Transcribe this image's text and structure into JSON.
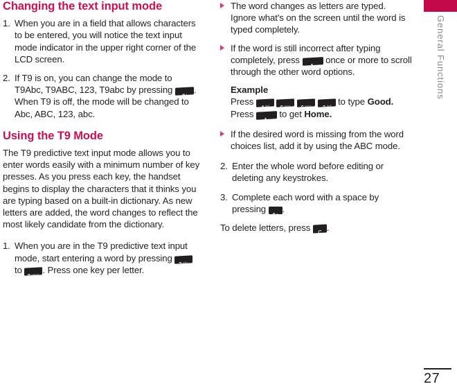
{
  "meta": {
    "accent_pink": "#cc1052",
    "tab_bar_color": "#c4084c",
    "key_color": "#231f20",
    "text_color": "#231f20"
  },
  "sidebar": {
    "chapter_label": "General Functions"
  },
  "folio": {
    "page_number": "27"
  },
  "left_column": {
    "heading_1": "Changing the text input mode",
    "item1": {
      "number": "1.",
      "text": "When you are in a field that allows characters to be entered, you will notice the text input mode indicator in the upper right corner of the LCD screen."
    },
    "item2": {
      "number": "2.",
      "text_a": "If T9 is on, you can change the mode to T9Abc, T9ABC, 123, T9abc by pressing",
      "key_hash": {
        "main": "#",
        "sub": ""
      },
      "text_b": ". When T9 is off, the mode will be changed to Abc, ABC, 123, abc."
    },
    "heading_2": "Using the T9 Mode",
    "paragraph": "The T9 predictive text input mode allows you to enter words easily with a minimum number of key presses. As you press each key, the handset begins to display the characters that it thinks you are typing based on a built-in dictionary. As new letters are added, the word changes to reflect the most likely candidate from the dictionary.",
    "item3": {
      "number": "1.",
      "text_a": "When you are in the T9 predictive text input mode, start entering a word by pressing",
      "key_2": {
        "main": "2",
        "sub": "abc"
      },
      "text_b": "to",
      "key_9": {
        "main": "9",
        "sub": "wxyz"
      },
      "text_c": ". Press one key per letter."
    }
  },
  "right_column": {
    "bullet_1": "The word changes as letters are typed. Ignore what's on the screen until the word is typed completely.",
    "bullet_2": {
      "text_a": "If the word is still incorrect after typing completely, press",
      "key_star": {
        "main": "*",
        "sub": ""
      },
      "text_b": "once or more to scroll through the other word options."
    },
    "example": {
      "label": "Example",
      "line1_press": "Press",
      "keys": [
        {
          "main": "4",
          "sub": "ghi"
        },
        {
          "main": "6",
          "sub": "mno"
        },
        {
          "main": "6",
          "sub": "mno"
        },
        {
          "main": "3",
          "sub": "def"
        }
      ],
      "line1_tail": "to type",
      "line1_word": "Good.",
      "line2_press": "Press",
      "line2_key": {
        "main": "*",
        "sub": ""
      },
      "line2_tail": "to get",
      "line2_word": "Home."
    },
    "bullet_3": "If the desired word is missing from the word choices list, add it by using the ABC mode.",
    "item2": {
      "number": "2.",
      "text": "Enter the whole word before editing or deleting any keystrokes."
    },
    "item3": {
      "number": "3.",
      "text_a": "Complete each word with a space by pressing",
      "key_0": {
        "main": "0",
        "sub": ""
      },
      "text_b": "."
    },
    "closing": {
      "text_a": "To delete letters, press",
      "key_clear": {
        "main": "C",
        "sub": ""
      },
      "text_b": "."
    }
  }
}
